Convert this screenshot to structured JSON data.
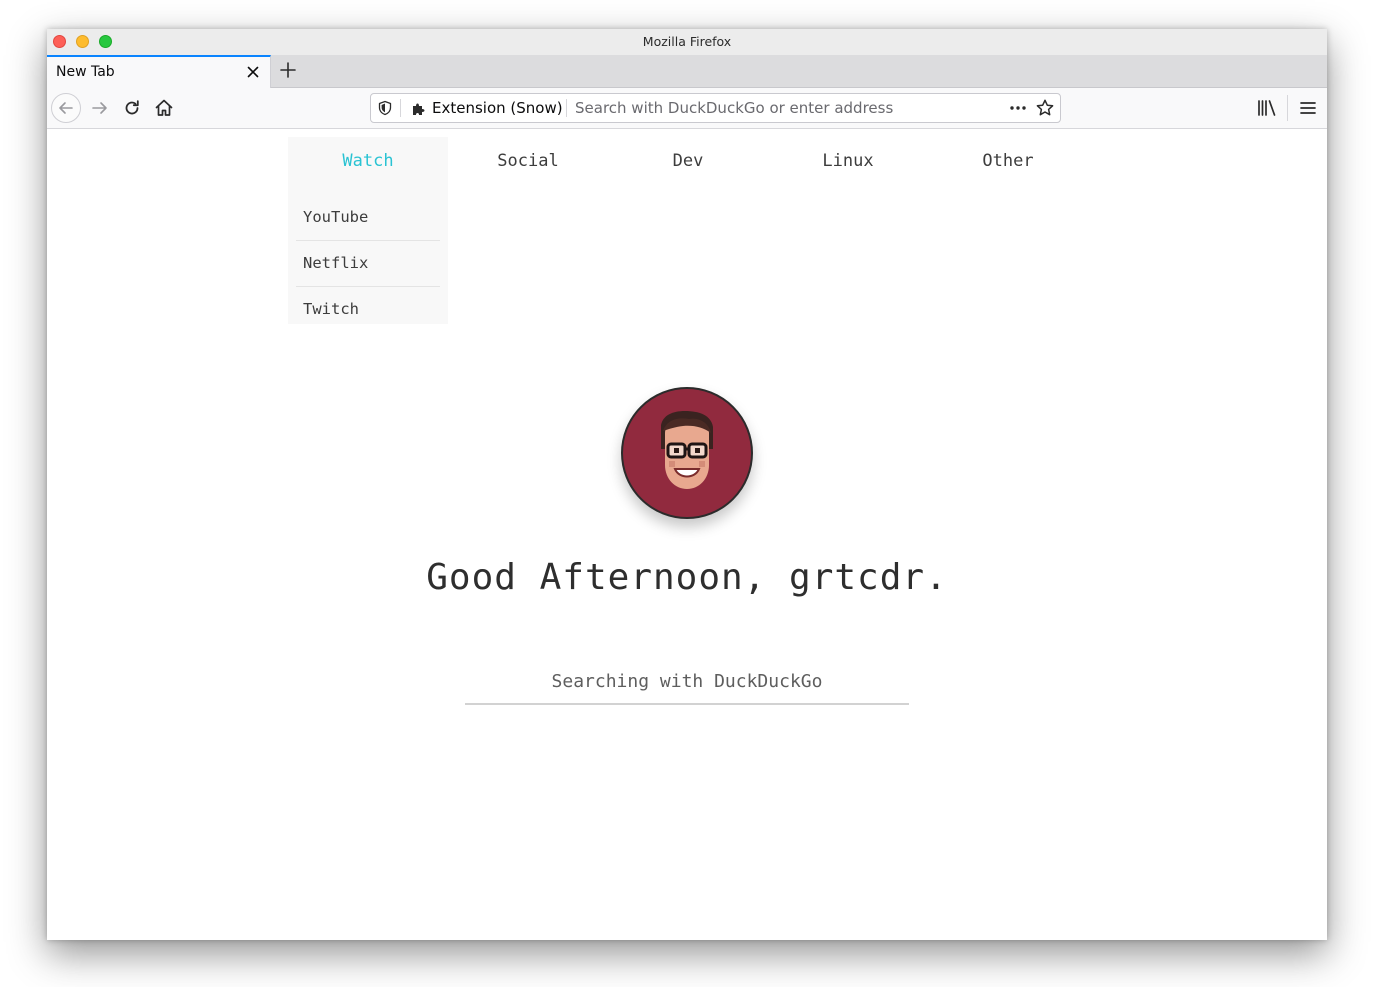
{
  "window": {
    "title": "Mozilla Firefox"
  },
  "tab": {
    "title": "New Tab"
  },
  "urlbar": {
    "identity_label": "Extension (Snow)",
    "placeholder": "Search with DuckDuckGo or enter address"
  },
  "links": {
    "categories": [
      {
        "label": "Watch",
        "active": true,
        "items": [
          "YouTube",
          "Netflix",
          "Twitch"
        ]
      },
      {
        "label": "Social"
      },
      {
        "label": "Dev"
      },
      {
        "label": "Linux"
      },
      {
        "label": "Other"
      }
    ]
  },
  "greeting": "Good Afternoon, grtcdr.",
  "search": {
    "placeholder": "Searching with DuckDuckGo"
  },
  "colors": {
    "accent": "#2ac3d3",
    "avatar_bg": "#912a3e",
    "tab_highlight": "#0a84ff"
  },
  "icons": [
    "shield-icon",
    "puzzle-icon",
    "more-dots-icon",
    "star-icon",
    "library-icon",
    "hamburger-menu-icon"
  ]
}
